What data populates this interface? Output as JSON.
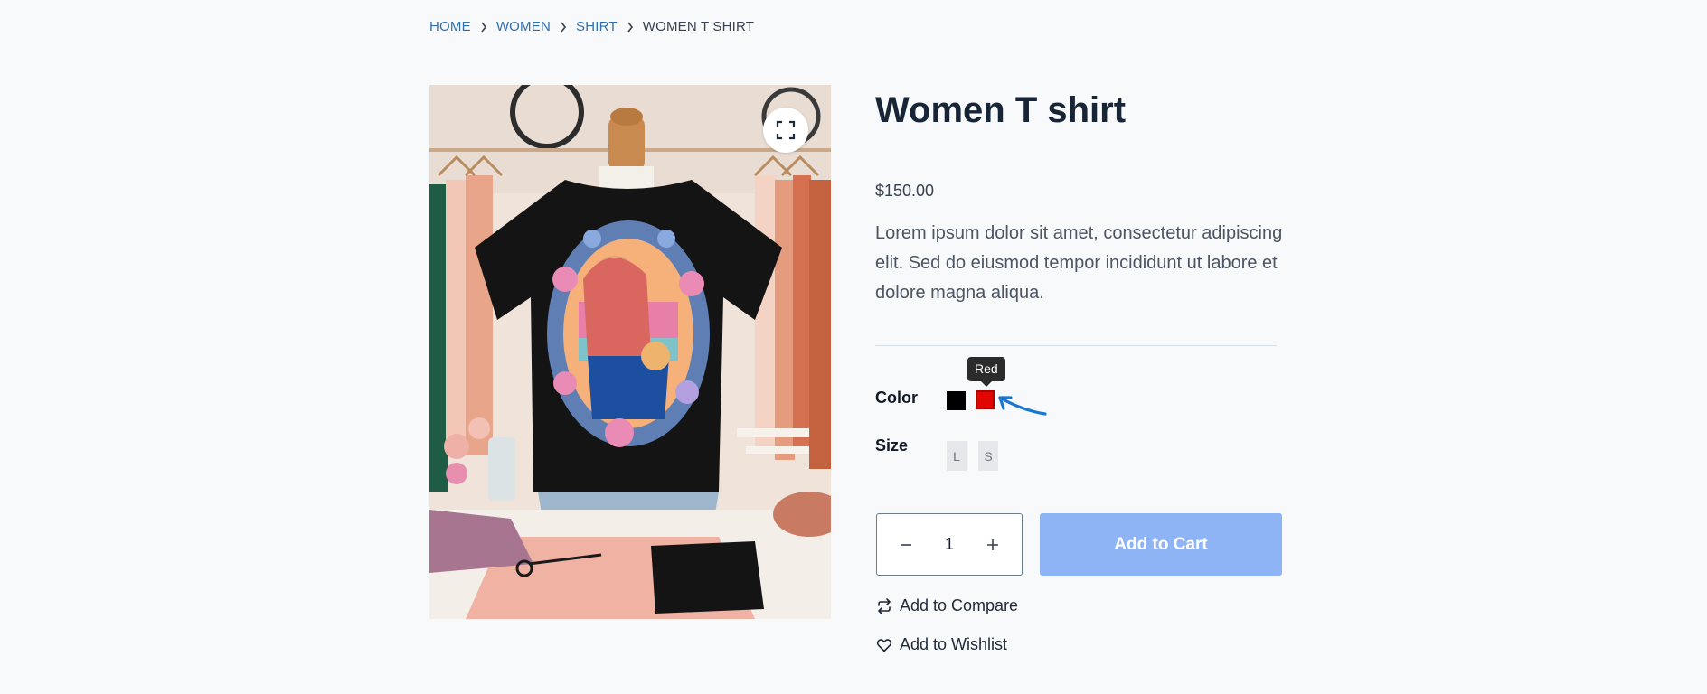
{
  "breadcrumb": {
    "items": [
      {
        "label": "HOME"
      },
      {
        "label": "WOMEN"
      },
      {
        "label": "SHIRT"
      }
    ],
    "current": "WOMEN T SHIRT"
  },
  "product": {
    "title": "Women T shirt",
    "price": "$150.00",
    "description": "Lorem ipsum dolor sit amet, consectetur adipiscing elit. Sed do eiusmod tempor incididunt ut labore et dolore magna aliqua.",
    "image_expand_icon": "expand-icon"
  },
  "options": {
    "color_label": "Color",
    "colors": [
      {
        "name": "Black",
        "hex": "#000000"
      },
      {
        "name": "Red",
        "hex": "#e10600",
        "selected": true
      }
    ],
    "tooltip": "Red",
    "size_label": "Size",
    "sizes": [
      "L",
      "S"
    ]
  },
  "cart": {
    "quantity": "1",
    "minus_icon": "minus-icon",
    "plus_icon": "plus-icon",
    "add_to_cart_label": "Add to Cart"
  },
  "actions": {
    "compare_label": "Add to Compare",
    "compare_icon": "compare-arrows-icon",
    "wishlist_label": "Add to Wishlist",
    "wishlist_icon": "heart-icon"
  },
  "colors": {
    "link": "#2f6fae",
    "title": "#172536",
    "add_to_cart_bg": "#8fb4f6",
    "annotation_arrow": "#1877d2"
  }
}
